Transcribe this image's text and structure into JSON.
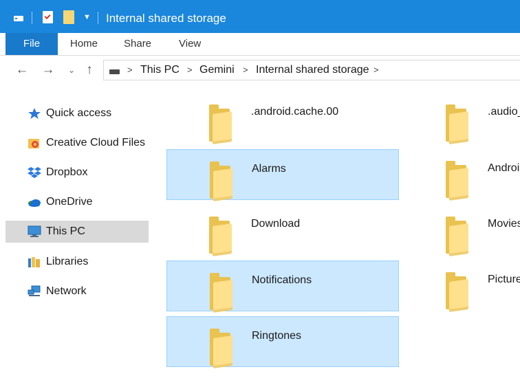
{
  "window": {
    "title": "Internal shared storage",
    "accent_color": "#1a86dc",
    "qat_icons": [
      "drive-icon",
      "properties-icon",
      "new-folder-icon",
      "customize-dropdown-icon"
    ]
  },
  "ribbon": {
    "tabs": [
      "File",
      "Home",
      "Share",
      "View"
    ]
  },
  "address": {
    "nav_icons": [
      "back-arrow-icon",
      "forward-arrow-icon",
      "recent-dropdown-icon",
      "up-arrow-icon"
    ],
    "breadcrumbs": [
      "This PC",
      "Gemini",
      "Internal shared storage"
    ],
    "separator": ">"
  },
  "nav_pane": {
    "items": [
      {
        "label": "Quick access",
        "icon": "star-icon"
      },
      {
        "label": "Creative Cloud Files",
        "icon": "creative-cloud-icon"
      },
      {
        "label": "Dropbox",
        "icon": "dropbox-icon"
      },
      {
        "label": "OneDrive",
        "icon": "onedrive-icon"
      },
      {
        "label": "This PC",
        "icon": "computer-icon",
        "selected": true
      },
      {
        "label": "Libraries",
        "icon": "libraries-icon"
      },
      {
        "label": "Network",
        "icon": "network-icon"
      }
    ]
  },
  "content": {
    "folders": [
      {
        "name": ".android.cache.00",
        "selected": false
      },
      {
        "name": ".audio_",
        "selected": false
      },
      {
        "name": "Alarms",
        "selected": true
      },
      {
        "name": "Androi",
        "selected": false
      },
      {
        "name": "Download",
        "selected": false
      },
      {
        "name": "Movies",
        "selected": false
      },
      {
        "name": "Notifications",
        "selected": true
      },
      {
        "name": "Picture",
        "selected": false
      },
      {
        "name": "Ringtones",
        "selected": true
      }
    ],
    "selection_color": "#cce8ff"
  }
}
